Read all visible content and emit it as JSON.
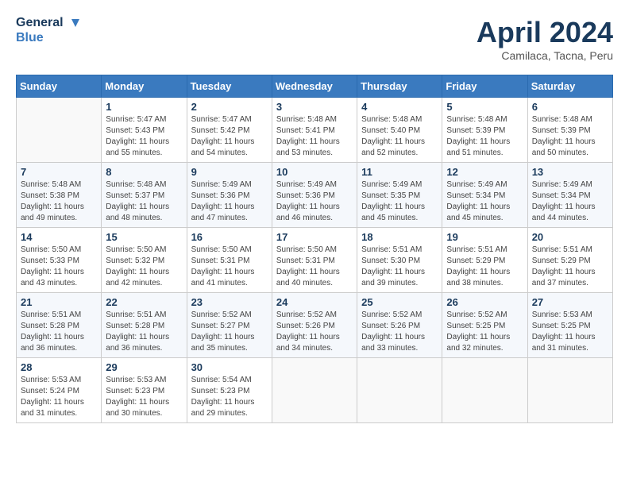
{
  "header": {
    "logo_line1": "General",
    "logo_line2": "Blue",
    "month": "April 2024",
    "location": "Camilaca, Tacna, Peru"
  },
  "weekdays": [
    "Sunday",
    "Monday",
    "Tuesday",
    "Wednesday",
    "Thursday",
    "Friday",
    "Saturday"
  ],
  "weeks": [
    [
      {
        "day": "",
        "info": ""
      },
      {
        "day": "1",
        "info": "Sunrise: 5:47 AM\nSunset: 5:43 PM\nDaylight: 11 hours\nand 55 minutes."
      },
      {
        "day": "2",
        "info": "Sunrise: 5:47 AM\nSunset: 5:42 PM\nDaylight: 11 hours\nand 54 minutes."
      },
      {
        "day": "3",
        "info": "Sunrise: 5:48 AM\nSunset: 5:41 PM\nDaylight: 11 hours\nand 53 minutes."
      },
      {
        "day": "4",
        "info": "Sunrise: 5:48 AM\nSunset: 5:40 PM\nDaylight: 11 hours\nand 52 minutes."
      },
      {
        "day": "5",
        "info": "Sunrise: 5:48 AM\nSunset: 5:39 PM\nDaylight: 11 hours\nand 51 minutes."
      },
      {
        "day": "6",
        "info": "Sunrise: 5:48 AM\nSunset: 5:39 PM\nDaylight: 11 hours\nand 50 minutes."
      }
    ],
    [
      {
        "day": "7",
        "info": "Sunrise: 5:48 AM\nSunset: 5:38 PM\nDaylight: 11 hours\nand 49 minutes."
      },
      {
        "day": "8",
        "info": "Sunrise: 5:48 AM\nSunset: 5:37 PM\nDaylight: 11 hours\nand 48 minutes."
      },
      {
        "day": "9",
        "info": "Sunrise: 5:49 AM\nSunset: 5:36 PM\nDaylight: 11 hours\nand 47 minutes."
      },
      {
        "day": "10",
        "info": "Sunrise: 5:49 AM\nSunset: 5:36 PM\nDaylight: 11 hours\nand 46 minutes."
      },
      {
        "day": "11",
        "info": "Sunrise: 5:49 AM\nSunset: 5:35 PM\nDaylight: 11 hours\nand 45 minutes."
      },
      {
        "day": "12",
        "info": "Sunrise: 5:49 AM\nSunset: 5:34 PM\nDaylight: 11 hours\nand 45 minutes."
      },
      {
        "day": "13",
        "info": "Sunrise: 5:49 AM\nSunset: 5:34 PM\nDaylight: 11 hours\nand 44 minutes."
      }
    ],
    [
      {
        "day": "14",
        "info": "Sunrise: 5:50 AM\nSunset: 5:33 PM\nDaylight: 11 hours\nand 43 minutes."
      },
      {
        "day": "15",
        "info": "Sunrise: 5:50 AM\nSunset: 5:32 PM\nDaylight: 11 hours\nand 42 minutes."
      },
      {
        "day": "16",
        "info": "Sunrise: 5:50 AM\nSunset: 5:31 PM\nDaylight: 11 hours\nand 41 minutes."
      },
      {
        "day": "17",
        "info": "Sunrise: 5:50 AM\nSunset: 5:31 PM\nDaylight: 11 hours\nand 40 minutes."
      },
      {
        "day": "18",
        "info": "Sunrise: 5:51 AM\nSunset: 5:30 PM\nDaylight: 11 hours\nand 39 minutes."
      },
      {
        "day": "19",
        "info": "Sunrise: 5:51 AM\nSunset: 5:29 PM\nDaylight: 11 hours\nand 38 minutes."
      },
      {
        "day": "20",
        "info": "Sunrise: 5:51 AM\nSunset: 5:29 PM\nDaylight: 11 hours\nand 37 minutes."
      }
    ],
    [
      {
        "day": "21",
        "info": "Sunrise: 5:51 AM\nSunset: 5:28 PM\nDaylight: 11 hours\nand 36 minutes."
      },
      {
        "day": "22",
        "info": "Sunrise: 5:51 AM\nSunset: 5:28 PM\nDaylight: 11 hours\nand 36 minutes."
      },
      {
        "day": "23",
        "info": "Sunrise: 5:52 AM\nSunset: 5:27 PM\nDaylight: 11 hours\nand 35 minutes."
      },
      {
        "day": "24",
        "info": "Sunrise: 5:52 AM\nSunset: 5:26 PM\nDaylight: 11 hours\nand 34 minutes."
      },
      {
        "day": "25",
        "info": "Sunrise: 5:52 AM\nSunset: 5:26 PM\nDaylight: 11 hours\nand 33 minutes."
      },
      {
        "day": "26",
        "info": "Sunrise: 5:52 AM\nSunset: 5:25 PM\nDaylight: 11 hours\nand 32 minutes."
      },
      {
        "day": "27",
        "info": "Sunrise: 5:53 AM\nSunset: 5:25 PM\nDaylight: 11 hours\nand 31 minutes."
      }
    ],
    [
      {
        "day": "28",
        "info": "Sunrise: 5:53 AM\nSunset: 5:24 PM\nDaylight: 11 hours\nand 31 minutes."
      },
      {
        "day": "29",
        "info": "Sunrise: 5:53 AM\nSunset: 5:23 PM\nDaylight: 11 hours\nand 30 minutes."
      },
      {
        "day": "30",
        "info": "Sunrise: 5:54 AM\nSunset: 5:23 PM\nDaylight: 11 hours\nand 29 minutes."
      },
      {
        "day": "",
        "info": ""
      },
      {
        "day": "",
        "info": ""
      },
      {
        "day": "",
        "info": ""
      },
      {
        "day": "",
        "info": ""
      }
    ]
  ]
}
